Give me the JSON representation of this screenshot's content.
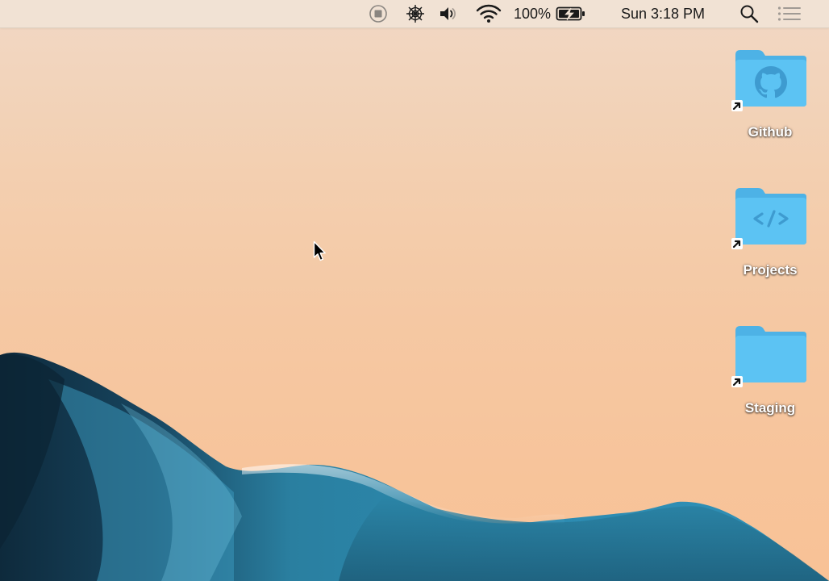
{
  "menubar": {
    "status_items": [
      {
        "name": "screen-record-icon"
      },
      {
        "name": "spider-web-icon"
      },
      {
        "name": "volume-icon"
      },
      {
        "name": "wifi-icon"
      }
    ],
    "battery_percent": "100%",
    "battery_icon": "battery-charging-icon",
    "clock": "Sun 3:18 PM",
    "search_icon": "spotlight-search-icon",
    "notification_icon": "notification-center-icon"
  },
  "desktop": {
    "icons": [
      {
        "label": "Github",
        "glyph": "github-icon"
      },
      {
        "label": "Projects",
        "glyph": "code-icon"
      },
      {
        "label": "Staging",
        "glyph": "folder-icon"
      }
    ]
  },
  "colors": {
    "sky_top": "#f1d8c5",
    "sky_bottom": "#f8c296",
    "wave_dark": "#13384e",
    "wave_mid": "#1f6f8f",
    "wave_light": "#3a9bbd",
    "folder_blue": "#5cc3f3",
    "folder_tab": "#4db2e6"
  }
}
